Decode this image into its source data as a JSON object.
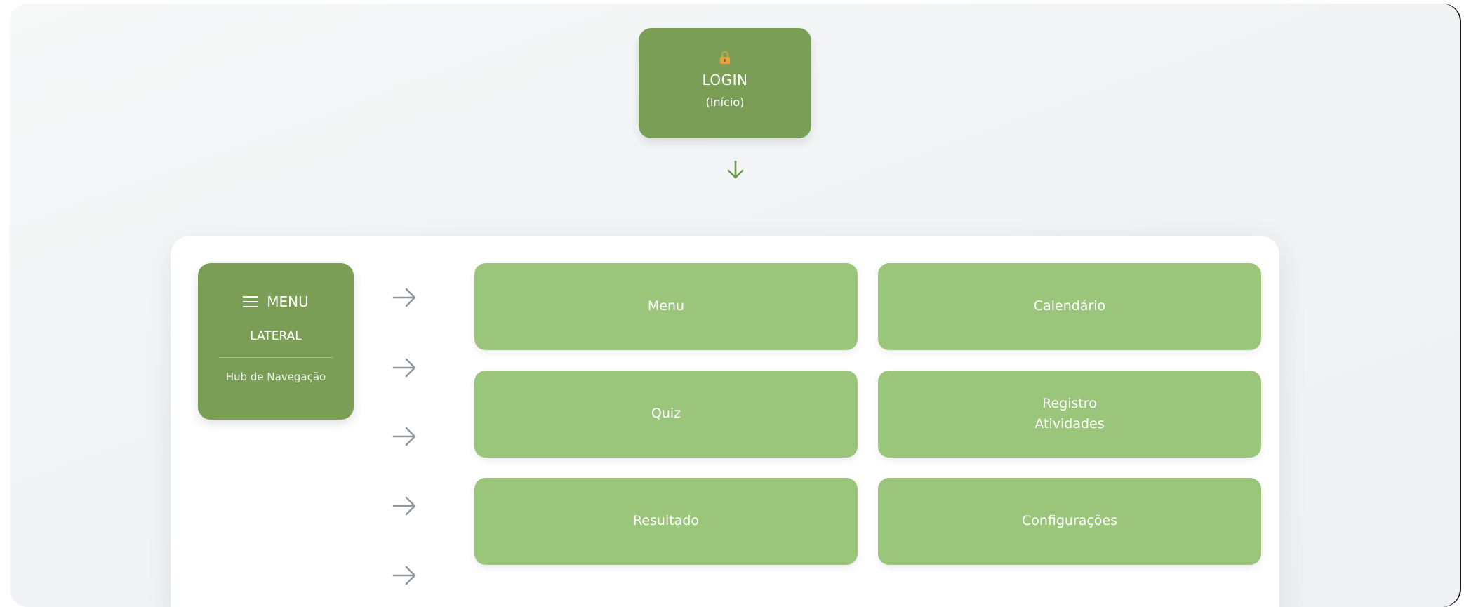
{
  "login": {
    "icon": "lock-icon",
    "title": "LOGIN",
    "subtitle": "(Início)"
  },
  "connector": {
    "icon": "arrow-down-icon",
    "color": "#6f9a4b"
  },
  "menu": {
    "icon": "hamburger-icon",
    "title": "MENU",
    "subtitle": "LATERAL",
    "description": "Hub de Navegação"
  },
  "arrows": {
    "icon": "arrow-right-icon",
    "count": 5,
    "color": "#8f969c"
  },
  "cards": [
    {
      "label": "Menu"
    },
    {
      "label": "Calendário"
    },
    {
      "label": "Quiz"
    },
    {
      "label": "Registro",
      "label2": "Atividades"
    },
    {
      "label": "Resultado"
    },
    {
      "label": "Configurações"
    }
  ],
  "colors": {
    "primary_dark_green": "#7b9e56",
    "card_light_green": "#9ac57b",
    "panel_white": "#ffffff",
    "background": "#f1f3f5"
  }
}
